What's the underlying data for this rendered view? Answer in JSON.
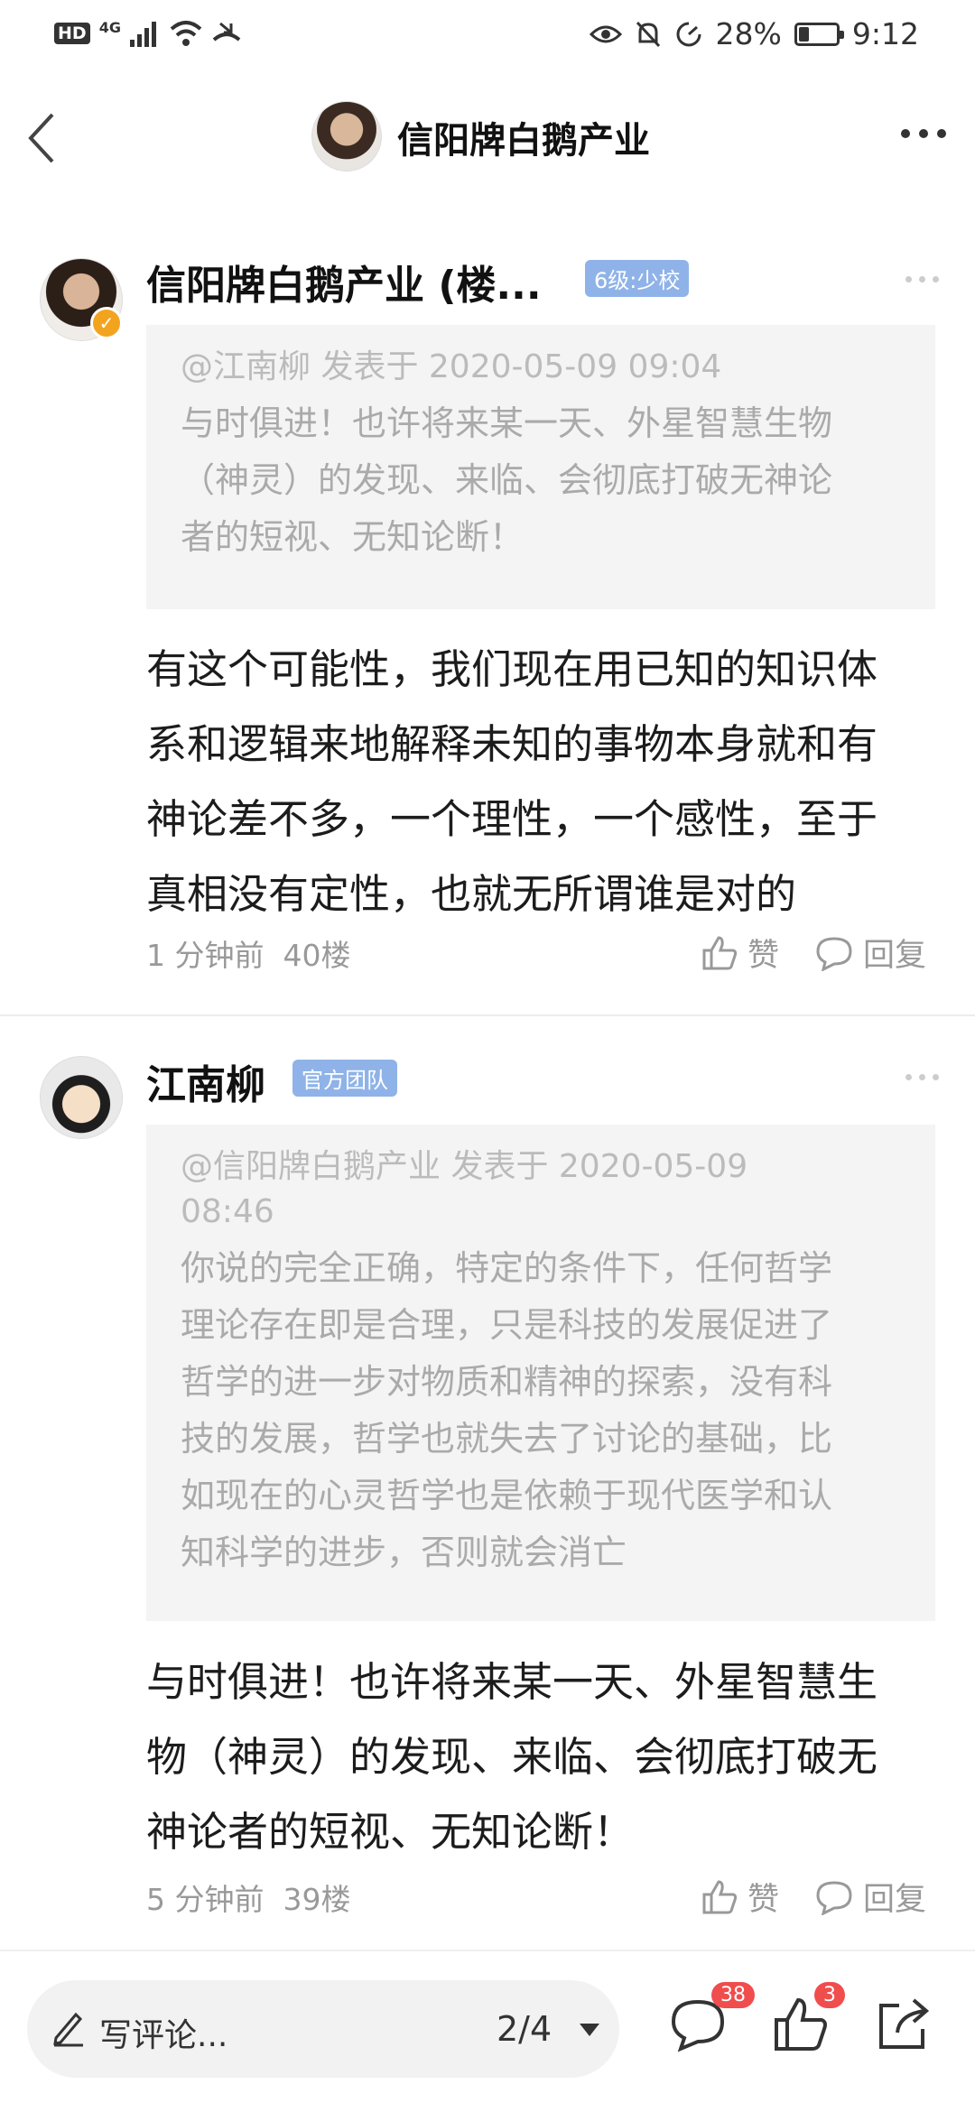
{
  "status_bar": {
    "hd": "HD",
    "network": "4G",
    "battery": "28%",
    "battery_level": 0.28,
    "time": "9:12"
  },
  "topnav": {
    "title": "信阳牌白鹅产业"
  },
  "comments": [
    {
      "username": "信阳牌白鹅产业 (楼...",
      "badge": "6级:少校",
      "quote_meta": "@江南柳 发表于 2020-05-09 09:04",
      "quote_lines": [
        "与时俱进！也许将来某一天、外星智慧生物",
        "（神灵）的发现、来临、会彻底打破无神论",
        "者的短视、无知论断！"
      ],
      "body_lines": [
        "有这个可能性，我们现在用已知的知识体",
        "系和逻辑来地解释未知的事物本身就和有",
        "神论差不多，一个理性，一个感性，至于",
        "真相没有定性，也就无所谓谁是对的"
      ],
      "time": "1 分钟前",
      "floor": "40楼",
      "like_label": "赞",
      "reply_label": "回复"
    },
    {
      "username": "江南柳",
      "badge": "官方团队",
      "quote_meta_lines": [
        "@信阳牌白鹅产业 发表于 2020-05-09",
        "08:46"
      ],
      "quote_lines": [
        "你说的完全正确，特定的条件下，任何哲学",
        "理论存在即是合理，只是科技的发展促进了",
        "哲学的进一步对物质和精神的探索，没有科",
        "技的发展，哲学也就失去了讨论的基础，比",
        "如现在的心灵哲学也是依赖于现代医学和认",
        "知科学的进步，否则就会消亡"
      ],
      "body_lines": [
        "与时俱进！也许将来某一天、外星智慧生",
        "物（神灵）的发现、来临、会彻底打破无",
        "神论者的短视、无知论断！"
      ],
      "time": "5 分钟前",
      "floor": "39楼",
      "like_label": "赞",
      "reply_label": "回复"
    }
  ],
  "bottom_bar": {
    "input_placeholder": "写评论...",
    "page_indicator": "2/4",
    "comment_count": "38",
    "like_count": "3"
  }
}
